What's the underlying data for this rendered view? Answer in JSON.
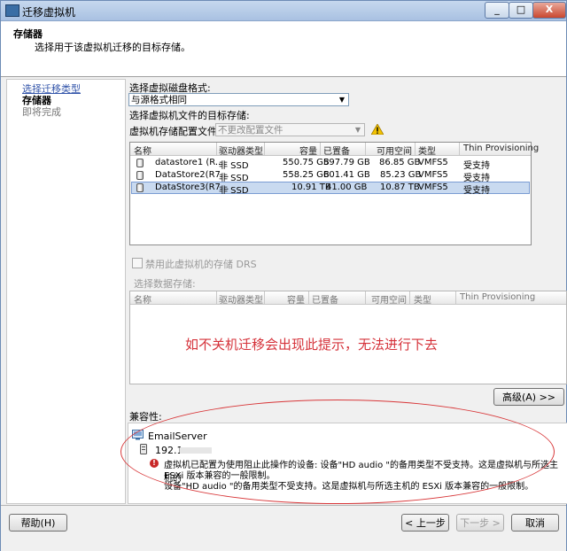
{
  "window": {
    "title": "迁移虚拟机",
    "controls": {
      "minimize": "_",
      "maximize": "□",
      "close": "X"
    }
  },
  "header": {
    "title": "存储器",
    "subtitle": "选择用于该虚拟机迁移的目标存储。"
  },
  "nav": {
    "items": [
      {
        "label": "选择迁移类型",
        "state": "link"
      },
      {
        "label": "存储器",
        "state": "current"
      },
      {
        "label": "即将完成",
        "state": "pending"
      }
    ]
  },
  "disk_format": {
    "label": "选择虚拟磁盘格式:",
    "value": "与源格式相同"
  },
  "target_storage_label": "选择虚拟机文件的目标存储:",
  "storage_profile": {
    "label": "虚拟机存储配置文件:",
    "value": "不更改配置文件"
  },
  "datastore_table": {
    "headers": [
      "名称",
      "驱动器类型",
      "容量",
      "已置备",
      "可用空间",
      "类型",
      "Thin Provisioning"
    ],
    "rows": [
      {
        "name": "datastore1 (R...",
        "drive": "非 SSD",
        "capacity": "550.75 GB",
        "provisioned": "597.79 GB",
        "free": "86.85 GB",
        "type": "VMFS5",
        "thin": "受支持",
        "selected": false
      },
      {
        "name": "DataStore2(R7...",
        "drive": "非 SSD",
        "capacity": "558.25 GB",
        "provisioned": "601.41 GB",
        "free": "85.23 GB",
        "type": "VMFS5",
        "thin": "受支持",
        "selected": false
      },
      {
        "name": "DataStore3(R7...",
        "drive": "非 SSD",
        "capacity": "10.91 TB",
        "provisioned": "41.00 GB",
        "free": "10.87 TB",
        "type": "VMFS5",
        "thin": "受支持",
        "selected": true
      }
    ]
  },
  "drs_checkbox": {
    "label": "禁用此虚拟机的存储 DRS",
    "checked": false
  },
  "select_datastore_label": "选择数据存储:",
  "datastore_table2": {
    "headers": [
      "名称",
      "驱动器类型",
      "容量",
      "已置备",
      "可用空间",
      "类型",
      "Thin Provisioning"
    ]
  },
  "annotation": "如不关机迁移会出现此提示，无法进行下去",
  "advanced_button": "高级(A) >>",
  "compatibility": {
    "label": "兼容性:",
    "vm_name": "EmailServer",
    "host": "192.1",
    "error_line1": "虚拟机已配置为使用阻止此操作的设备: 设备\"HD audio \"的备用类型不受支持。这是虚拟机与所选主机的",
    "error_line2": "ESXi 版本兼容的一般限制。",
    "error_line3": "设备\"HD audio \"的备用类型不受支持。这是虚拟机与所选主机的 ESXi 版本兼容的一般限制。"
  },
  "footer": {
    "help": "帮助(H)",
    "back": "< 上一步",
    "next": "下一步 >",
    "cancel": "取消"
  },
  "colors": {
    "accent": "#3355aa",
    "selection": "#c9daf0",
    "error": "#c82828",
    "annotation": "#d5323a"
  }
}
